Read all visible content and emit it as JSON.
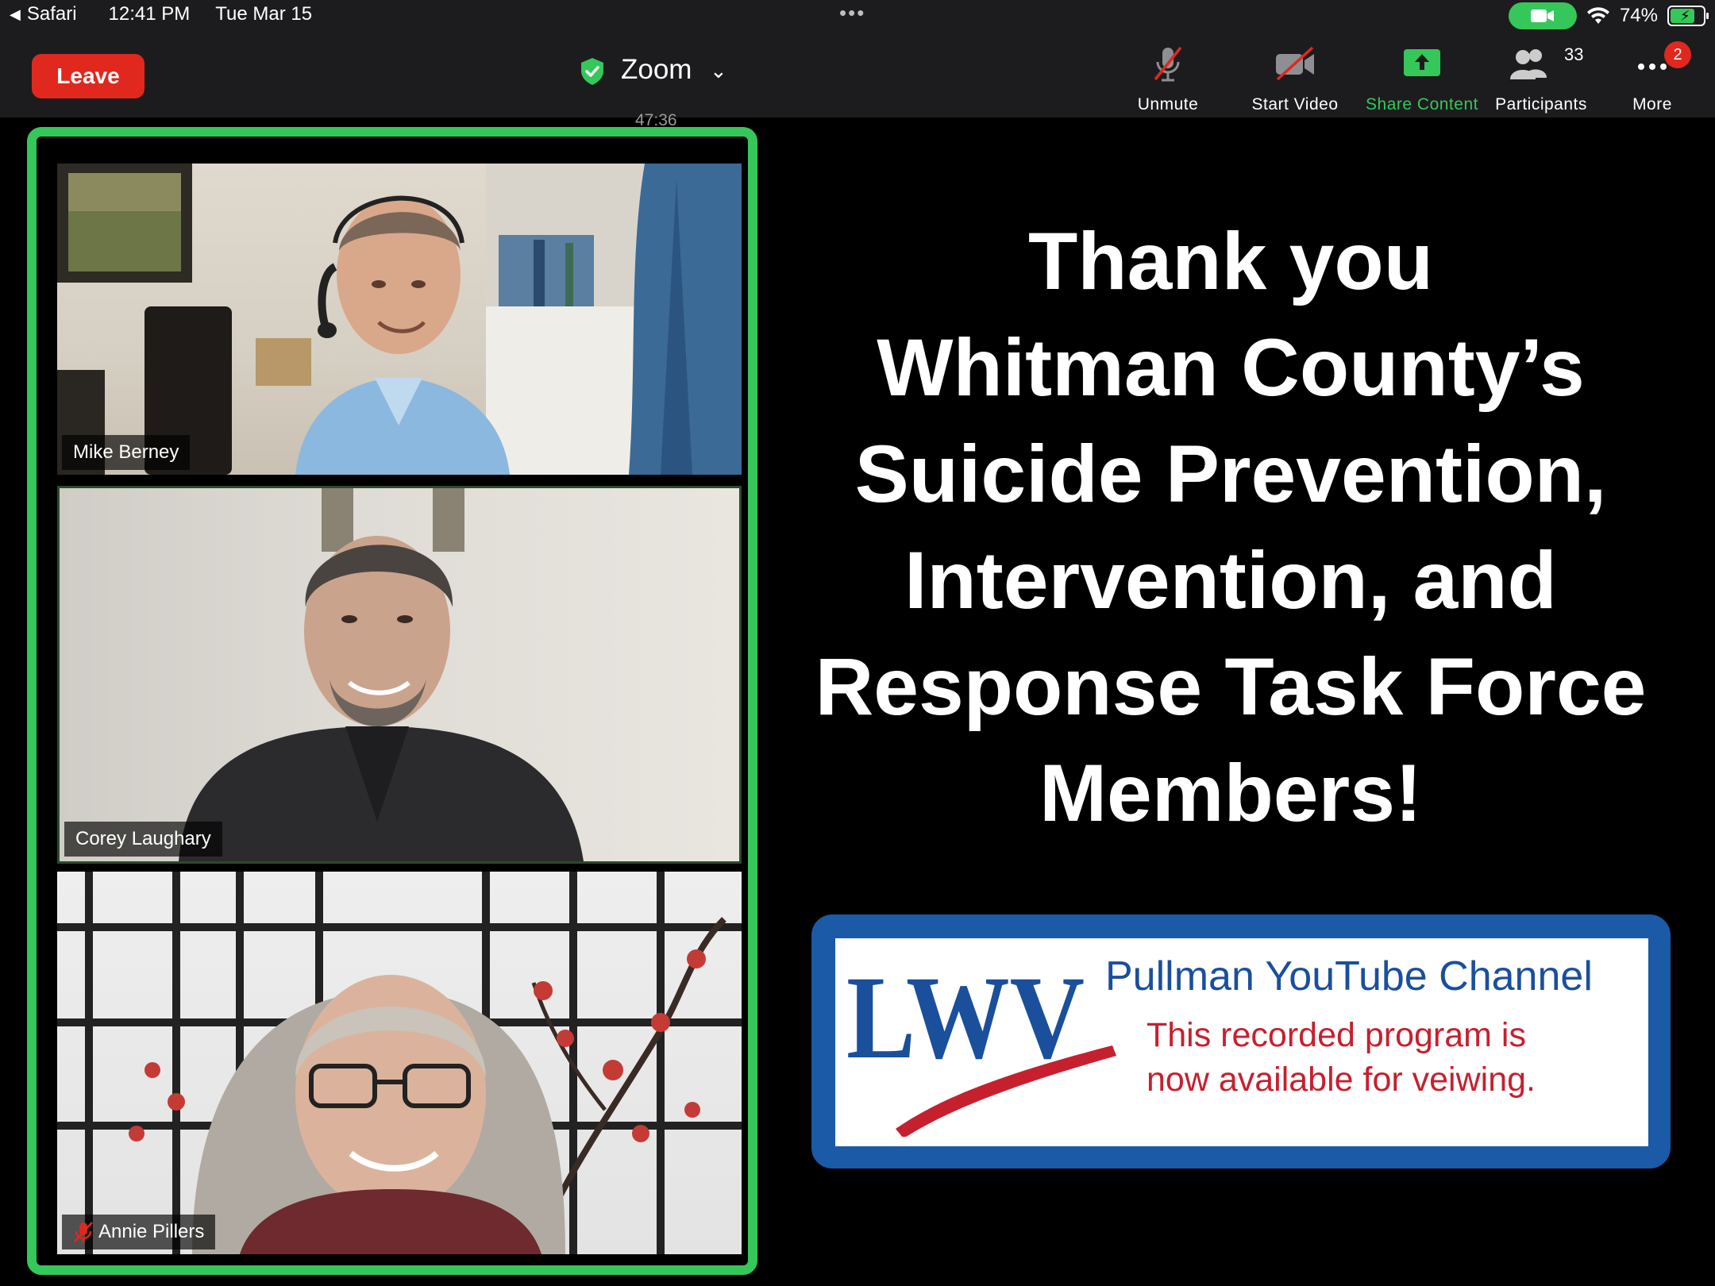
{
  "status_bar": {
    "back_app": "Safari",
    "time": "12:41 PM",
    "date": "Tue Mar 15",
    "battery_percent": "74%",
    "battery_level": 0.74,
    "camera_indicator_color": "#35c759"
  },
  "toolbar": {
    "leave_label": "Leave",
    "meeting_title": "Zoom",
    "meeting_timer": "47:36",
    "unmute_label": "Unmute",
    "start_video_label": "Start Video",
    "share_label": "Share Content",
    "participants_label": "Participants",
    "participants_count": "33",
    "more_label": "More",
    "more_badge": "2",
    "accent_green": "#35c759",
    "leave_red": "#e0281e"
  },
  "participants": [
    {
      "name": "Mike Berney",
      "muted": false
    },
    {
      "name": "Corey Laughary",
      "muted": false
    },
    {
      "name": "Annie Pillers",
      "muted": true
    }
  ],
  "slide": {
    "lines": [
      "Thank you",
      "Whitman County’s",
      "Suicide Prevention,",
      "Intervention, and",
      "Response Task Force",
      "Members!"
    ],
    "banner": {
      "logo_text": "LWV",
      "title": "Pullman YouTube Channel",
      "subtitle_line1": "This recorded program is",
      "subtitle_line2": "now available for veiwing.",
      "border_color": "#1a5aa6",
      "title_color": "#1a4f9c",
      "subtitle_color": "#c6202f"
    }
  }
}
